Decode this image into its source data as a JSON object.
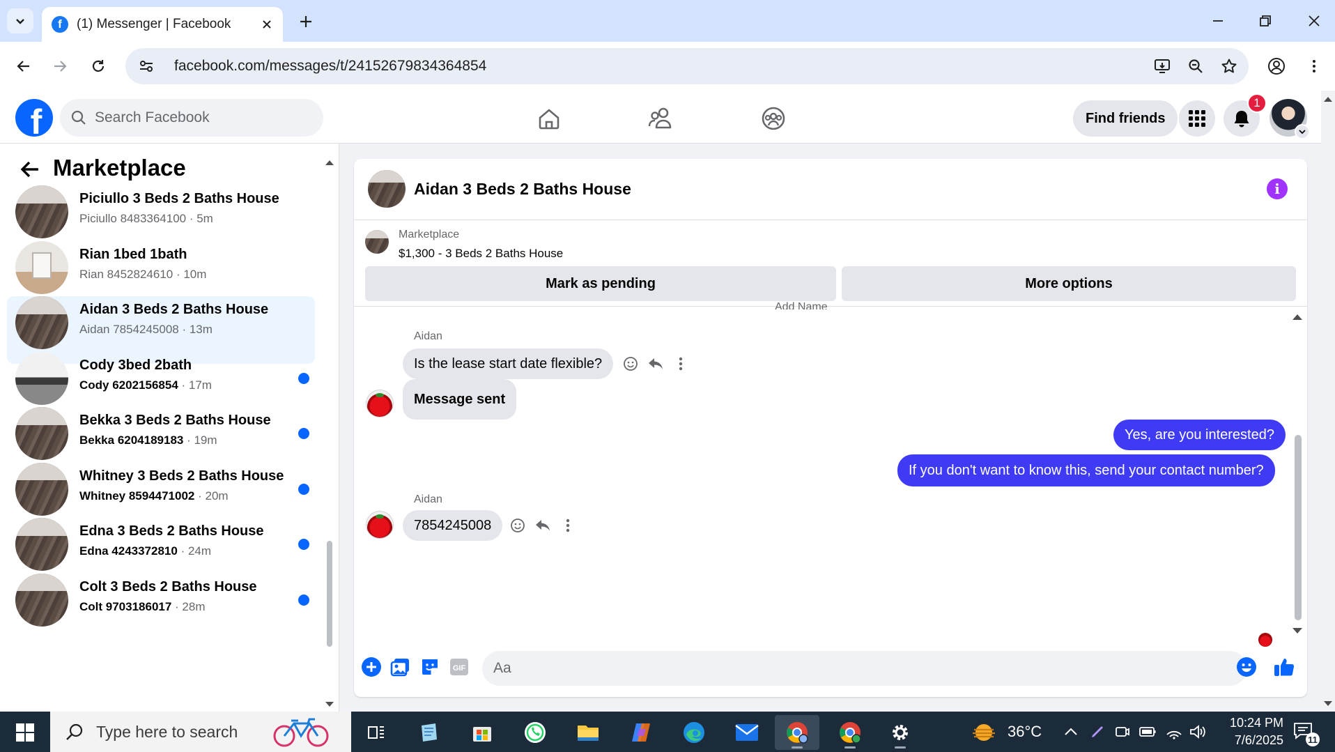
{
  "browser": {
    "tab_title": "(1) Messenger | Facebook",
    "url": "facebook.com/messages/t/24152679834364854"
  },
  "facebook": {
    "logo_letter": "f",
    "search_placeholder": "Search Facebook",
    "find_friends_label": "Find friends",
    "notification_count": "1"
  },
  "sidebar": {
    "title": "Marketplace",
    "conversations": [
      {
        "name": "Piciullo 3 Beds 2 Baths House",
        "preview": "Piciullo 8483364100",
        "time": " · 5m",
        "unread": false,
        "active": false,
        "thumb": "floor"
      },
      {
        "name": "Rian 1bed 1bath",
        "preview": "Rian 8452824610",
        "time": " · 10m",
        "unread": false,
        "active": false,
        "thumb": "room"
      },
      {
        "name": "Aidan 3 Beds 2 Baths House",
        "preview": "Aidan 7854245008",
        "time": " · 13m",
        "unread": false,
        "active": true,
        "thumb": "floor"
      },
      {
        "name": "Cody 3bed 2bath",
        "preview": "Cody 6202156854",
        "time": " · 17m",
        "unread": true,
        "active": false,
        "thumb": "kitchen"
      },
      {
        "name": "Bekka 3 Beds 2 Baths House",
        "preview": "Bekka 6204189183",
        "time": " · 19m",
        "unread": true,
        "active": false,
        "thumb": "floor"
      },
      {
        "name": "Whitney 3 Beds 2 Baths House",
        "preview": "Whitney 8594471002",
        "time": " · 20m",
        "unread": true,
        "active": false,
        "thumb": "floor"
      },
      {
        "name": "Edna 3 Beds 2 Baths House",
        "preview": "Edna 4243372810",
        "time": " · 24m",
        "unread": true,
        "active": false,
        "thumb": "floor"
      },
      {
        "name": "Colt 3 Beds 2 Baths House",
        "preview": "Colt 9703186017",
        "time": " · 28m",
        "unread": true,
        "active": false,
        "thumb": "floor"
      }
    ]
  },
  "chat": {
    "title": "Aidan 3 Beds 2 Baths House",
    "info_glyph": "i",
    "listing": {
      "source": "Marketplace",
      "description": "$1,300 - 3 Beds 2 Baths House",
      "mark_pending_label": "Mark as pending",
      "more_options_label": "More options"
    },
    "cutoff_text": "Add        Name",
    "messages": {
      "sender_1": "Aidan",
      "msg_1": "Is the lease start date flexible?",
      "msg_2": "Message sent",
      "out_1": "Yes, are you interested?",
      "out_2": "If you don't want to know this, send your contact number?",
      "sender_2": "Aidan",
      "msg_3": "7854245008"
    },
    "composer_placeholder": "Aa"
  },
  "taskbar": {
    "search_placeholder": "Type here to search",
    "temperature": "36°C",
    "time": "10:24 PM",
    "date": "7/6/2025",
    "notification_count": "11"
  },
  "colors": {
    "facebook_blue": "#0866ff",
    "outgoing_bubble": "#3f3bf5",
    "info_purple": "#a033ff",
    "notification_red": "#e41e3f"
  }
}
